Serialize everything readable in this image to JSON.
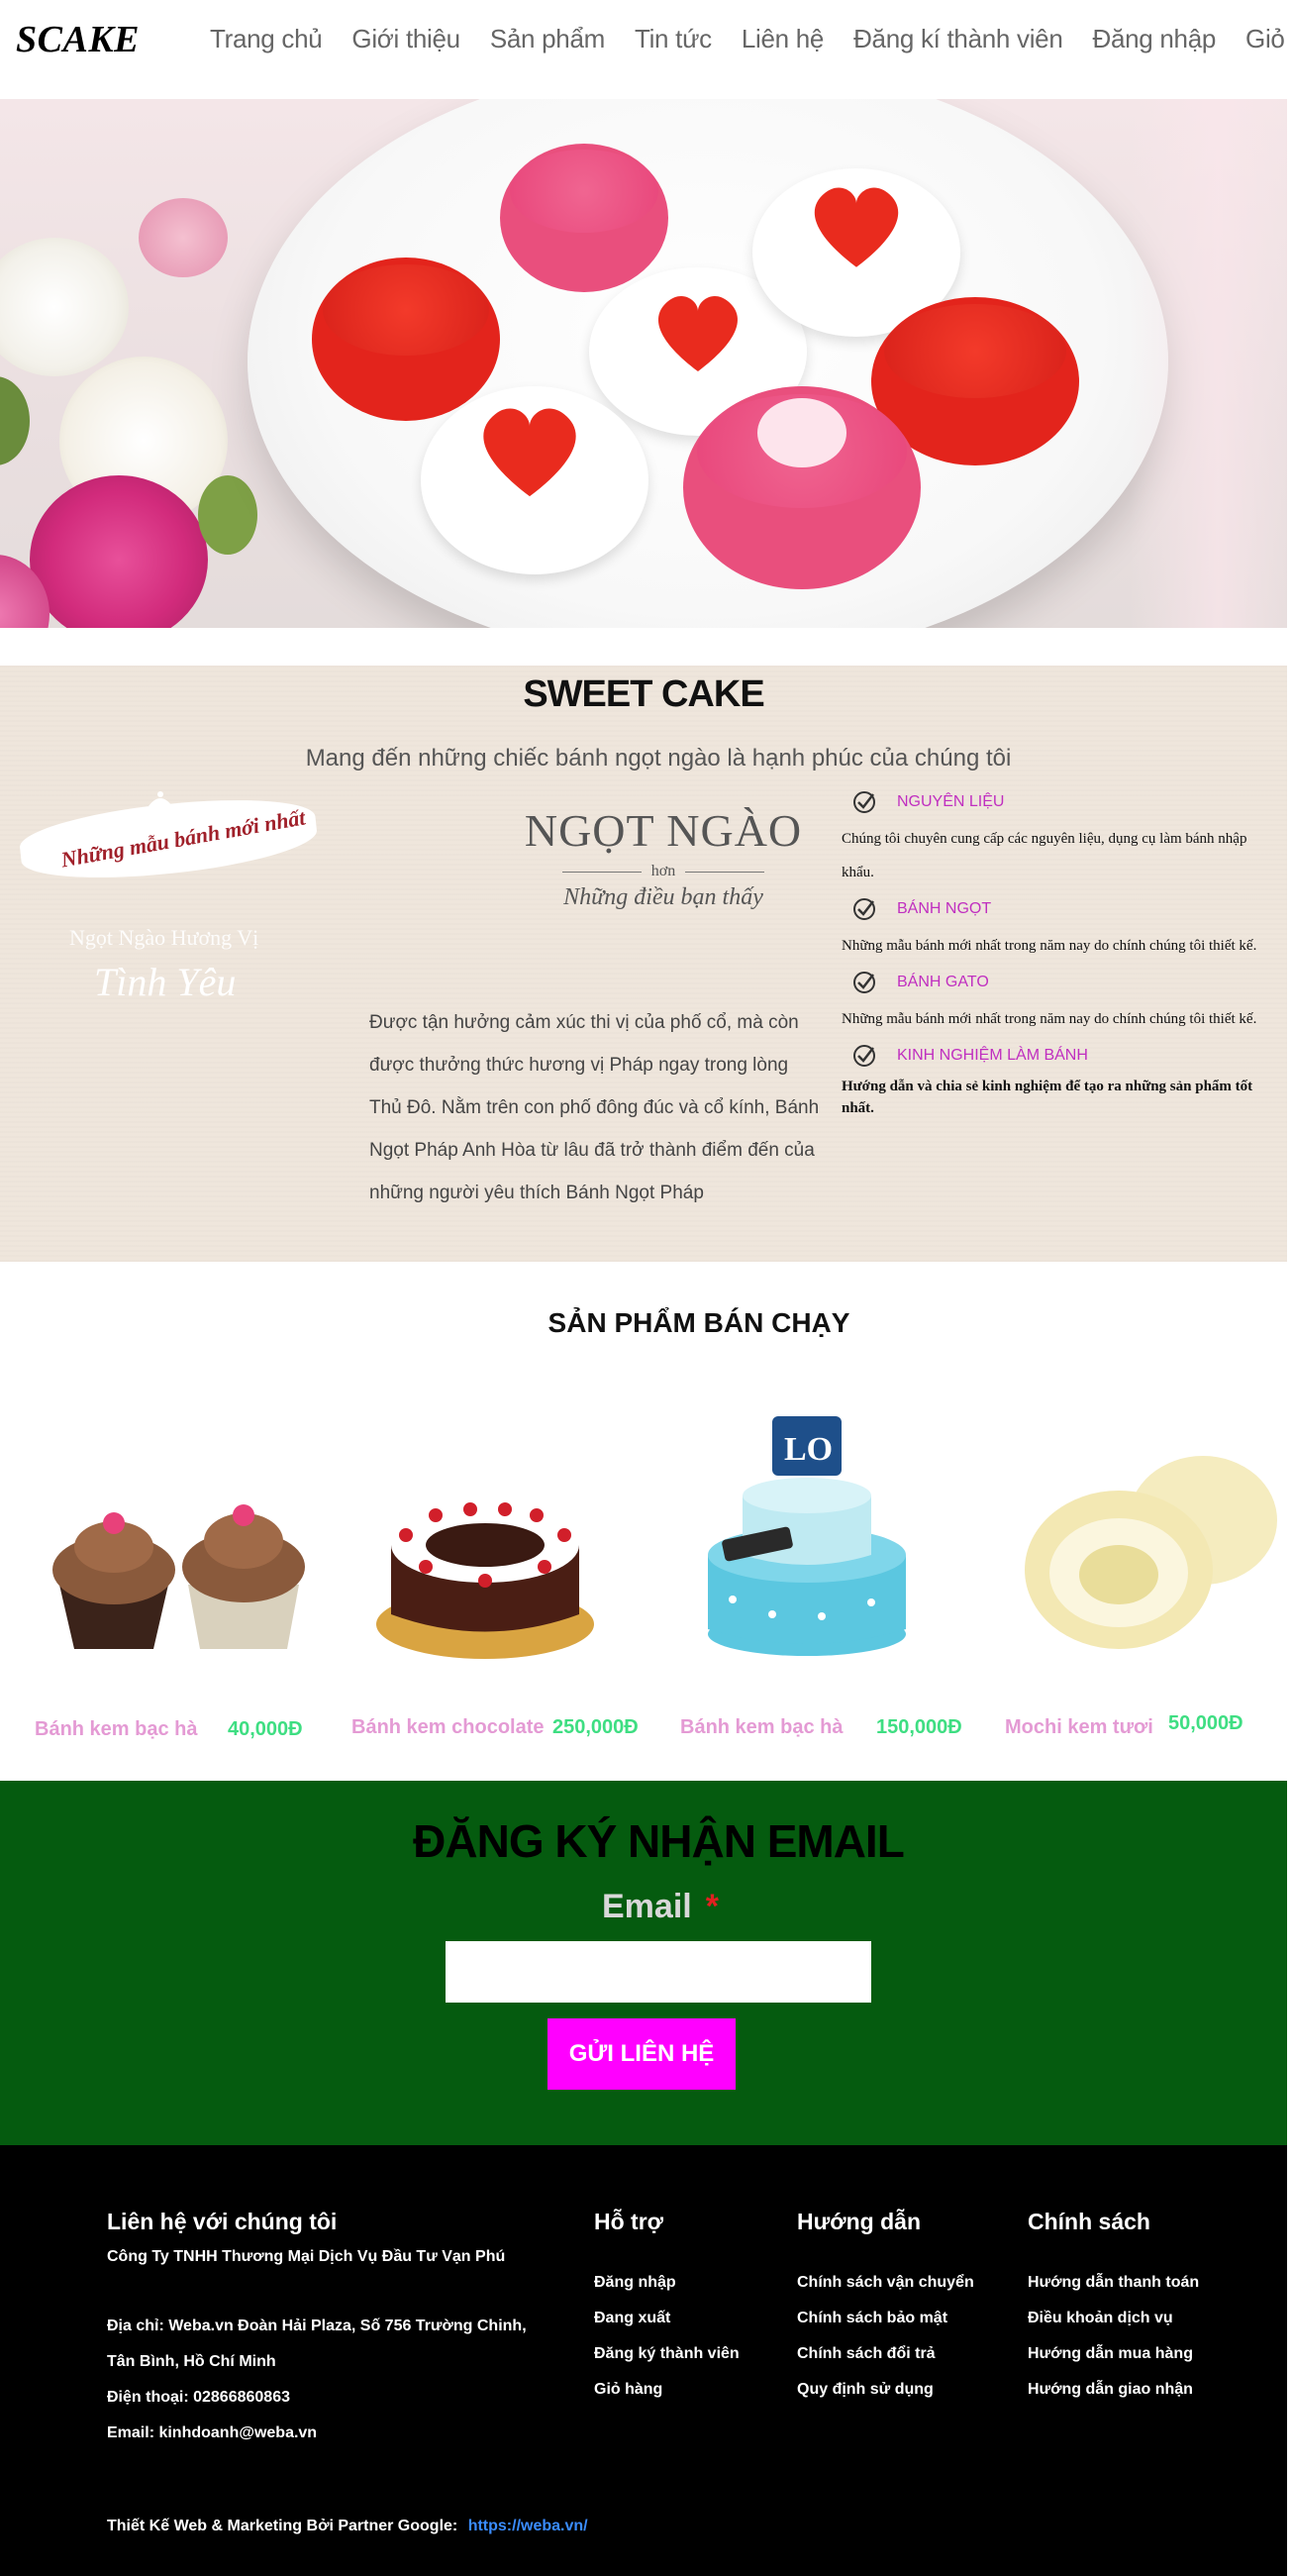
{
  "brand": {
    "logo": "SCAKE"
  },
  "nav": [
    "Trang chủ",
    "Giới thiệu",
    "Sản phẩm",
    "Tin tức",
    "Liên hệ",
    "Đăng kí thành viên",
    "Đăng nhập",
    "Giỏ Hàng"
  ],
  "intro": {
    "title": "SWEET CAKE",
    "subtitle": "Mang đến những chiếc bánh ngọt ngào là hạnh phúc của chúng tôi",
    "badge": {
      "ribbon": "Những mẫu bánh mới nhất",
      "line1": "Ngọt Ngào Hương Vị",
      "line2": "Tình Yêu"
    },
    "ngot_ngao": {
      "title": "NGỌT NGÀO",
      "middle": "hơn",
      "script": "Những điều bạn thấy"
    },
    "about": "Được tận hưởng cảm xúc thi vị của phố cổ, mà còn được thưởng thức hương vị Pháp ngay trong lòng Thủ Đô. Nằm trên con phố đông đúc và cổ kính, Bánh Ngọt Pháp Anh Hòa từ lâu đã trở thành điểm đến của những người yêu thích Bánh Ngọt Pháp",
    "features": [
      {
        "label": "NGUYÊN LIỆU",
        "text": "Chúng tôi chuyên cung cấp các nguyên liệu, dụng cụ làm bánh nhập khẩu."
      },
      {
        "label": "BÁNH NGỌT",
        "text": "Những mẫu bánh mới nhất trong năm nay do chính chúng tôi thiết kế."
      },
      {
        "label": "BÁNH GATO",
        "text": "Những mẫu bánh mới nhất trong năm nay do chính chúng tôi thiết kế."
      },
      {
        "label": "KINH NGHIỆM LÀM BÁNH",
        "text": "Hướng dẫn và chia sẻ kinh nghiệm để tạo ra những sản phẩm tốt nhất."
      }
    ]
  },
  "bestsellers": {
    "title": "SẢN PHẨM BÁN CHẠY",
    "items": [
      {
        "name": "Bánh kem bạc hà",
        "price": "40,000Đ",
        "icon": "cupcake-image"
      },
      {
        "name": "Bánh kem chocolate",
        "price": "250,000Đ",
        "icon": "chocolate-cake-image"
      },
      {
        "name": "Bánh kem bạc hà",
        "price": "150,000Đ",
        "icon": "blue-cake-image"
      },
      {
        "name": "Mochi kem tươi",
        "price": "50,000Đ",
        "icon": "mochi-image"
      }
    ]
  },
  "newsletter": {
    "title": "ĐĂNG KÝ NHẬN EMAIL",
    "label": "Email",
    "required": "*",
    "input_value": "",
    "button": "GỬI LIÊN HỆ"
  },
  "footer": {
    "contact": {
      "heading": "Liên hệ với chúng tôi",
      "company": "Công Ty TNHH Thương Mại Dịch Vụ Đầu Tư Vạn Phú",
      "address": "Địa chỉ: Weba.vn Đoàn Hải Plaza, Số 756 Trường Chinh, Tân Bình, Hồ Chí Minh",
      "phone": "Điện thoại: 02866860863",
      "email": "Email: kinhdoanh@weba.vn"
    },
    "support": {
      "heading": "Hỗ trợ",
      "links": [
        "Đăng nhập",
        "Đang xuất",
        "Đăng ký thành viên",
        "Giỏ hàng"
      ]
    },
    "guide": {
      "heading": "Hướng dẫn",
      "links": [
        "Chính sách vận chuyển",
        "Chính sách bảo mật",
        "Chính sách đổi trả",
        "Quy định sử dụng"
      ]
    },
    "policy": {
      "heading": "Chính sách",
      "links": [
        "Hướng dẫn thanh toán",
        "Điều khoản dịch vụ",
        "Hướng dẫn mua hàng",
        "Hướng dẫn giao nhận"
      ]
    },
    "credit": "Thiết Kế Web & Marketing Bởi Partner Google:",
    "credit_link": "https://weba.vn/"
  },
  "colors": {
    "product_name": "#e49ad4",
    "product_price": "#3ede82",
    "feature_label": "#c02fc0",
    "newsletter_bg": "#055b0f",
    "button_bg": "#ff00ff",
    "footer_bg": "#000000",
    "link": "#3a8cff"
  }
}
